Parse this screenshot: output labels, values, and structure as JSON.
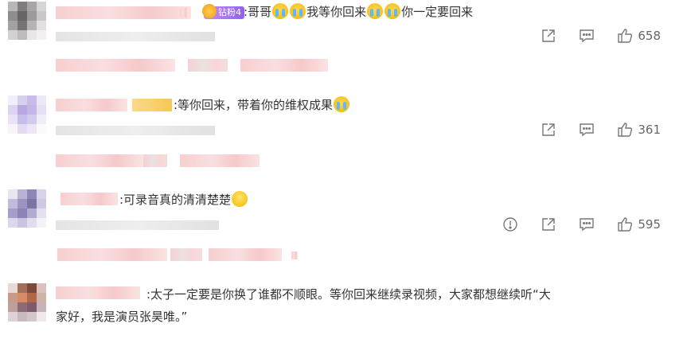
{
  "comments": [
    {
      "badge": "钻粉4",
      "text_parts": [
        ":哥哥",
        "我等你回来",
        "你一定要回来"
      ],
      "likes": "658"
    },
    {
      "text_parts": [
        ":等你回来，带着你的维权成果"
      ],
      "likes": "361"
    },
    {
      "text_parts": [
        ":可录音真的清清楚楚"
      ],
      "likes": "595"
    },
    {
      "text": ":太子一定要是你换了谁都不顺眼。等你回来继续录视频，大家都想继续听“大家好，我是演员张昊唯。”"
    }
  ],
  "icons": {
    "share": "share-icon",
    "comment": "comment-icon",
    "like": "thumbs-up-icon",
    "report": "report-icon",
    "cry_emoji": "crying-face-emoji",
    "grin_emoji": "grinning-face-emoji"
  }
}
